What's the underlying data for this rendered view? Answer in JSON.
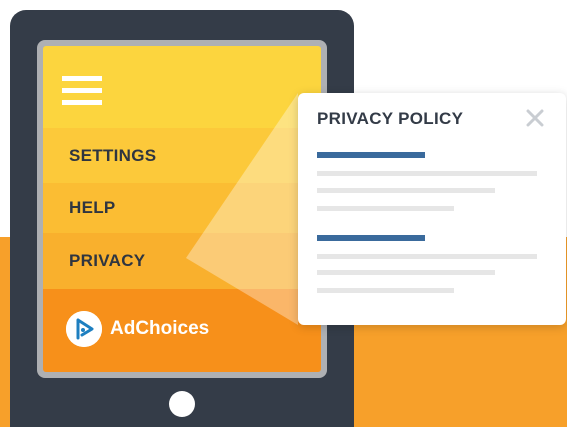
{
  "menu": {
    "items": [
      {
        "label": "SETTINGS"
      },
      {
        "label": "HELP"
      },
      {
        "label": "PRIVACY"
      }
    ],
    "adchoices": {
      "label": "AdChoices",
      "icon": "adchoices-play-icon"
    }
  },
  "popup": {
    "title": "PRIVACY POLICY",
    "close_icon": "close-icon"
  },
  "colors": {
    "background_band": "#f7a02a",
    "tablet_frame": "#343c48",
    "accent_blue": "#3a6a9c",
    "menu_yellow": "#fcd53e",
    "adchoices_orange": "#f7901a"
  }
}
